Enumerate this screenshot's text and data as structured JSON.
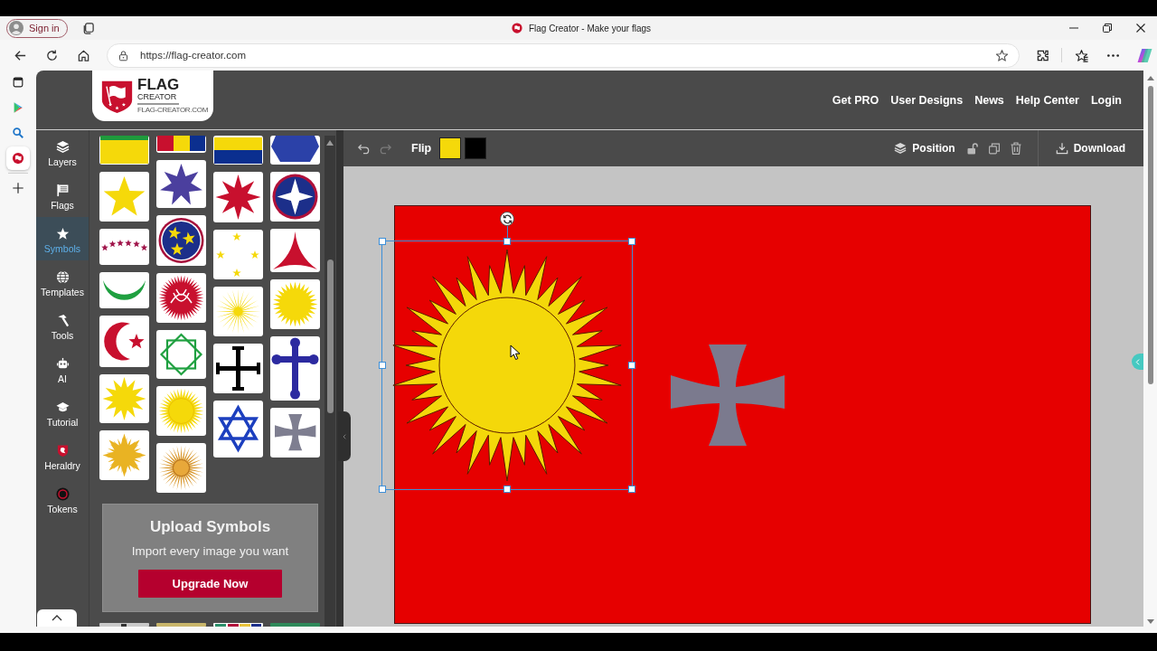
{
  "browser": {
    "profile_button": "Sign in",
    "tab_title": "Flag Creator - Make your flags",
    "address": "https://flag-creator.com",
    "side_apps": [
      {
        "selected": false
      },
      {
        "selected": false
      },
      {
        "selected": false
      },
      {
        "selected": true
      }
    ]
  },
  "header": {
    "logo": {
      "title": "FLAG",
      "subtitle": "CREATOR",
      "domain": "FLAG-CREATOR.COM"
    },
    "nav": [
      "Get PRO",
      "User Designs",
      "News",
      "Help Center",
      "Login"
    ]
  },
  "sidebar": {
    "items": [
      {
        "label": "Layers",
        "selected": false
      },
      {
        "label": "Flags",
        "selected": false
      },
      {
        "label": "Symbols",
        "selected": true
      },
      {
        "label": "Templates",
        "selected": false
      },
      {
        "label": "Tools",
        "selected": false
      },
      {
        "label": "AI",
        "selected": false
      },
      {
        "label": "Tutorial",
        "selected": false
      },
      {
        "label": "Heraldry",
        "selected": false
      },
      {
        "label": "Tokens",
        "selected": false
      }
    ]
  },
  "upload_card": {
    "title": "Upload Symbols",
    "text": "Import every image you want",
    "button": "Upgrade Now"
  },
  "toolbar": {
    "undo": {
      "disabled": false
    },
    "redo": {
      "disabled": true
    },
    "flip": "Flip",
    "swatches": [
      {
        "color": "#f5d90a"
      },
      {
        "color": "#000000"
      }
    ],
    "position": "Position",
    "download": "Download"
  },
  "canvas": {
    "objects": [
      {
        "kind": "sun",
        "selected": true
      },
      {
        "kind": "cross",
        "selected": false
      }
    ]
  }
}
